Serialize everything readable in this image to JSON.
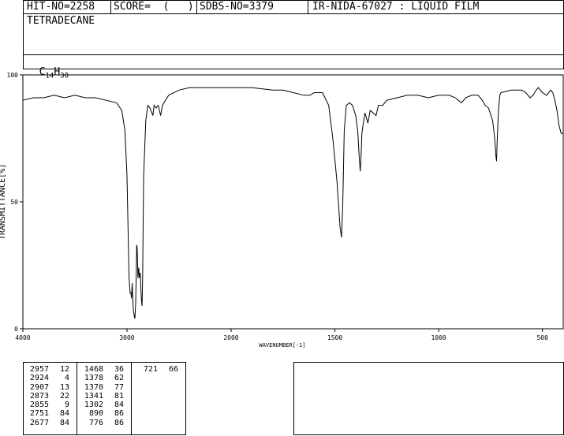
{
  "header": {
    "hit_no": "HIT-NO=2258",
    "score": "SCORE=  (   )",
    "sdbs_no": "SDBS-NO=3379",
    "ir_id": "IR-NIDA-67027 : LIQUID FILM",
    "compound": "TETRADECANE",
    "formula_base": "C",
    "formula_sub1": "14",
    "formula_mid": "H",
    "formula_sub2": "30"
  },
  "chart_data": {
    "type": "line",
    "xlabel": "WAVENUMBER[-1]",
    "ylabel": "TRANSMITTANCE[%]",
    "xlim": [
      4000,
      400
    ],
    "ylim": [
      0,
      100
    ],
    "xticks": [
      4000,
      3000,
      2000,
      1500,
      1000,
      500
    ],
    "yticks": [
      0,
      50,
      100
    ],
    "series": [
      {
        "points": [
          [
            4000,
            90
          ],
          [
            3900,
            91
          ],
          [
            3800,
            91
          ],
          [
            3700,
            92
          ],
          [
            3600,
            91
          ],
          [
            3500,
            92
          ],
          [
            3400,
            91
          ],
          [
            3300,
            91
          ],
          [
            3200,
            90
          ],
          [
            3100,
            89
          ],
          [
            3050,
            86
          ],
          [
            3020,
            78
          ],
          [
            3000,
            60
          ],
          [
            2990,
            40
          ],
          [
            2980,
            20
          ],
          [
            2970,
            14
          ],
          [
            2962,
            14
          ],
          [
            2957,
            12
          ],
          [
            2950,
            18
          ],
          [
            2940,
            8
          ],
          [
            2930,
            5
          ],
          [
            2924,
            4
          ],
          [
            2917,
            10
          ],
          [
            2912,
            20
          ],
          [
            2907,
            33
          ],
          [
            2902,
            32
          ],
          [
            2895,
            20
          ],
          [
            2887,
            24
          ],
          [
            2880,
            20
          ],
          [
            2873,
            22
          ],
          [
            2866,
            15
          ],
          [
            2862,
            12
          ],
          [
            2858,
            10
          ],
          [
            2855,
            9
          ],
          [
            2850,
            20
          ],
          [
            2840,
            60
          ],
          [
            2820,
            82
          ],
          [
            2800,
            88
          ],
          [
            2780,
            87
          ],
          [
            2751,
            84
          ],
          [
            2740,
            88
          ],
          [
            2720,
            87
          ],
          [
            2700,
            88
          ],
          [
            2677,
            84
          ],
          [
            2660,
            88
          ],
          [
            2630,
            90
          ],
          [
            2600,
            92
          ],
          [
            2500,
            94
          ],
          [
            2400,
            95
          ],
          [
            2300,
            95
          ],
          [
            2200,
            95
          ],
          [
            2100,
            95
          ],
          [
            2000,
            95
          ],
          [
            1900,
            95
          ],
          [
            1800,
            94
          ],
          [
            1750,
            94
          ],
          [
            1700,
            93
          ],
          [
            1650,
            92
          ],
          [
            1620,
            92
          ],
          [
            1600,
            93
          ],
          [
            1560,
            93
          ],
          [
            1530,
            88
          ],
          [
            1510,
            75
          ],
          [
            1490,
            58
          ],
          [
            1475,
            40
          ],
          [
            1468,
            36
          ],
          [
            1462,
            50
          ],
          [
            1455,
            78
          ],
          [
            1445,
            88
          ],
          [
            1430,
            89
          ],
          [
            1415,
            88
          ],
          [
            1400,
            84
          ],
          [
            1390,
            78
          ],
          [
            1383,
            68
          ],
          [
            1378,
            62
          ],
          [
            1373,
            70
          ],
          [
            1370,
            77
          ],
          [
            1365,
            80
          ],
          [
            1355,
            85
          ],
          [
            1341,
            81
          ],
          [
            1330,
            86
          ],
          [
            1315,
            85
          ],
          [
            1302,
            84
          ],
          [
            1290,
            88
          ],
          [
            1270,
            88
          ],
          [
            1250,
            90
          ],
          [
            1200,
            91
          ],
          [
            1150,
            92
          ],
          [
            1100,
            92
          ],
          [
            1050,
            91
          ],
          [
            1000,
            92
          ],
          [
            950,
            92
          ],
          [
            920,
            91
          ],
          [
            890,
            89
          ],
          [
            870,
            91
          ],
          [
            840,
            92
          ],
          [
            810,
            92
          ],
          [
            790,
            90
          ],
          [
            776,
            88
          ],
          [
            760,
            87
          ],
          [
            740,
            82
          ],
          [
            730,
            75
          ],
          [
            724,
            68
          ],
          [
            721,
            66
          ],
          [
            718,
            74
          ],
          [
            712,
            86
          ],
          [
            705,
            92
          ],
          [
            700,
            93
          ],
          [
            650,
            94
          ],
          [
            600,
            94
          ],
          [
            580,
            93
          ],
          [
            560,
            91
          ],
          [
            545,
            92
          ],
          [
            530,
            94
          ],
          [
            520,
            95
          ],
          [
            500,
            93
          ],
          [
            480,
            92
          ],
          [
            460,
            94
          ],
          [
            450,
            93
          ],
          [
            440,
            90
          ],
          [
            430,
            86
          ],
          [
            420,
            80
          ],
          [
            410,
            77
          ],
          [
            400,
            77
          ]
        ]
      }
    ],
    "peaks": [
      [
        "2957",
        "12"
      ],
      [
        "2924",
        "4"
      ],
      [
        "2907",
        "13"
      ],
      [
        "2873",
        "22"
      ],
      [
        "2855",
        "9"
      ],
      [
        "2751",
        "84"
      ],
      [
        "2677",
        "84"
      ],
      [
        "1468",
        "36"
      ],
      [
        "1378",
        "62"
      ],
      [
        "1370",
        "77"
      ],
      [
        "1341",
        "81"
      ],
      [
        "1302",
        "84"
      ],
      [
        "890",
        "86"
      ],
      [
        "776",
        "86"
      ],
      [
        "721",
        "66"
      ]
    ]
  },
  "peak_table": {
    "col1": [
      [
        "2957",
        "12"
      ],
      [
        "2924",
        "4"
      ],
      [
        "2907",
        "13"
      ],
      [
        "2873",
        "22"
      ],
      [
        "2855",
        "9"
      ],
      [
        "2751",
        "84"
      ],
      [
        "2677",
        "84"
      ]
    ],
    "col2": [
      [
        "1468",
        "36"
      ],
      [
        "1378",
        "62"
      ],
      [
        "1370",
        "77"
      ],
      [
        "1341",
        "81"
      ],
      [
        "1302",
        "84"
      ],
      [
        "890",
        "86"
      ],
      [
        "776",
        "86"
      ]
    ],
    "col3": [
      [
        "721",
        "66"
      ]
    ]
  }
}
